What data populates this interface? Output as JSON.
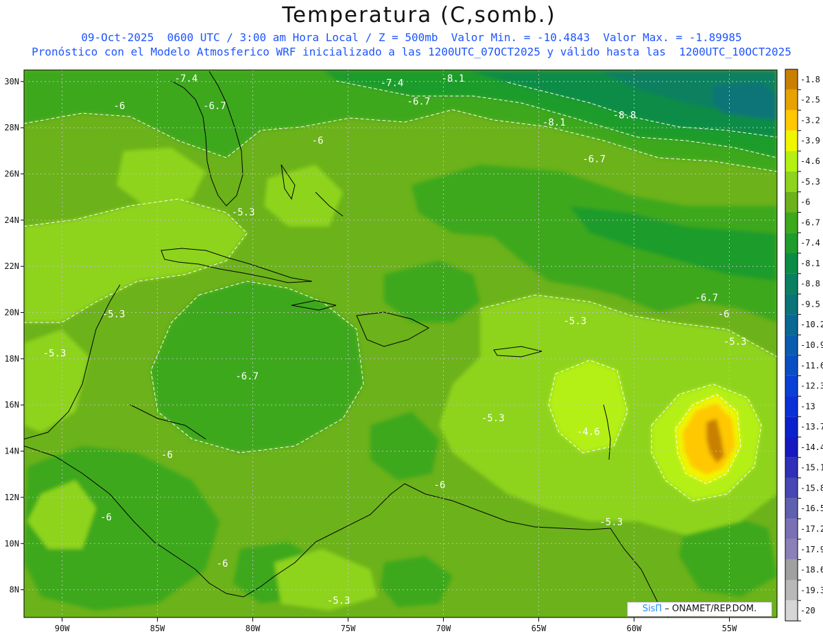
{
  "header": {
    "title": "Temperatura (C,somb.)",
    "subtitle_line1": "09-Oct-2025  0600 UTC / 3:00 am Hora Local / Z = 500mb  Valor Min. = -10.4843  Valor Max. = -1.89985",
    "subtitle_line2": "Pronóstico con el Modelo Atmosferico WRF inicializado a las 1200UTC_07OCT2025 y válido hasta las  1200UTC_10OCT2025"
  },
  "map": {
    "lon_range": [
      -92,
      -52.5
    ],
    "lat_range": [
      6.8,
      30.5
    ],
    "lon_ticks": [
      {
        "value": -90,
        "label": "90W"
      },
      {
        "value": -85,
        "label": "85W"
      },
      {
        "value": -80,
        "label": "80W"
      },
      {
        "value": -75,
        "label": "75W"
      },
      {
        "value": -70,
        "label": "70W"
      },
      {
        "value": -65,
        "label": "65W"
      },
      {
        "value": -60,
        "label": "60W"
      },
      {
        "value": -55,
        "label": "55W"
      }
    ],
    "lat_ticks": [
      {
        "value": 8,
        "label": "8N"
      },
      {
        "value": 10,
        "label": "10N"
      },
      {
        "value": 12,
        "label": "12N"
      },
      {
        "value": 14,
        "label": "14N"
      },
      {
        "value": 16,
        "label": "16N"
      },
      {
        "value": 18,
        "label": "18N"
      },
      {
        "value": 20,
        "label": "20N"
      },
      {
        "value": 22,
        "label": "22N"
      },
      {
        "value": 24,
        "label": "24N"
      },
      {
        "value": 26,
        "label": "26N"
      },
      {
        "value": 28,
        "label": "28N"
      },
      {
        "value": 30,
        "label": "30N"
      }
    ],
    "contour_labels": [
      {
        "text": "-7.4",
        "lon": -83.5,
        "lat": 30.0
      },
      {
        "text": "-7.4",
        "lon": -72.7,
        "lat": 29.8
      },
      {
        "text": "-8.1",
        "lon": -69.5,
        "lat": 30.0
      },
      {
        "text": "-6",
        "lon": -87.0,
        "lat": 28.8
      },
      {
        "text": "-6.7",
        "lon": -82.0,
        "lat": 28.8
      },
      {
        "text": "-6.7",
        "lon": -71.3,
        "lat": 29.0
      },
      {
        "text": "-8.1",
        "lon": -64.2,
        "lat": 28.1
      },
      {
        "text": "-8.8",
        "lon": -60.5,
        "lat": 28.4
      },
      {
        "text": "-6",
        "lon": -76.6,
        "lat": 27.3
      },
      {
        "text": "-6.7",
        "lon": -62.1,
        "lat": 26.5
      },
      {
        "text": "-5.3",
        "lon": -80.5,
        "lat": 24.2
      },
      {
        "text": "-6.7",
        "lon": -56.2,
        "lat": 20.5
      },
      {
        "text": "-6",
        "lon": -55.3,
        "lat": 19.8
      },
      {
        "text": "-5.3",
        "lon": -87.3,
        "lat": 19.8
      },
      {
        "text": "-5.3",
        "lon": -63.1,
        "lat": 19.5
      },
      {
        "text": "-5.3",
        "lon": -54.7,
        "lat": 18.6
      },
      {
        "text": "-5.3",
        "lon": -90.4,
        "lat": 18.1
      },
      {
        "text": "-6.7",
        "lon": -80.3,
        "lat": 17.1
      },
      {
        "text": "-5.3",
        "lon": -67.4,
        "lat": 15.3
      },
      {
        "text": "-4.6",
        "lon": -62.4,
        "lat": 14.7
      },
      {
        "text": "-6",
        "lon": -84.5,
        "lat": 13.7
      },
      {
        "text": "-6",
        "lon": -70.2,
        "lat": 12.4
      },
      {
        "text": "-6",
        "lon": -87.7,
        "lat": 11.0
      },
      {
        "text": "-5.3",
        "lon": -61.2,
        "lat": 10.8
      },
      {
        "text": "-6",
        "lon": -81.6,
        "lat": 9.0
      },
      {
        "text": "-5.3",
        "lon": -75.5,
        "lat": 7.4
      }
    ]
  },
  "colorbar": {
    "levels": [
      {
        "label": "-1.8",
        "color": "#c98000"
      },
      {
        "label": "-2.5",
        "color": "#e8a200"
      },
      {
        "label": "-3.2",
        "color": "#ffc800"
      },
      {
        "label": "-3.9",
        "color": "#f0f500"
      },
      {
        "label": "-4.6",
        "color": "#b4f012"
      },
      {
        "label": "-5.3",
        "color": "#8ed41e"
      },
      {
        "label": "-6",
        "color": "#6cb21a"
      },
      {
        "label": "-6.7",
        "color": "#3ca81c"
      },
      {
        "label": "-7.4",
        "color": "#1f9c2c"
      },
      {
        "label": "-8.1",
        "color": "#0b8c46"
      },
      {
        "label": "-8.8",
        "color": "#0a8060"
      },
      {
        "label": "-9.5",
        "color": "#0a7478"
      },
      {
        "label": "-10.2",
        "color": "#0a6894"
      },
      {
        "label": "-10.9",
        "color": "#0a5cae"
      },
      {
        "label": "-11.6",
        "color": "#0a4ec4"
      },
      {
        "label": "-12.3",
        "color": "#0a40d4"
      },
      {
        "label": "-13",
        "color": "#0a30d8"
      },
      {
        "label": "-13.7",
        "color": "#0a22cc"
      },
      {
        "label": "-14.4",
        "color": "#1818c0"
      },
      {
        "label": "-15.1",
        "color": "#3030b8"
      },
      {
        "label": "-15.8",
        "color": "#4848b4"
      },
      {
        "label": "-16.5",
        "color": "#6060b0"
      },
      {
        "label": "-17.2",
        "color": "#7a70b4"
      },
      {
        "label": "-17.9",
        "color": "#8c80b8"
      },
      {
        "label": "-18.6",
        "color": "#a0a0a0"
      },
      {
        "label": "-19.3",
        "color": "#b8b8b8"
      },
      {
        "label": "-20",
        "color": "#d6d6d6"
      }
    ]
  },
  "credit": {
    "sis": "SisΠ",
    "org": " – ONAMET/REP.DOM."
  }
}
